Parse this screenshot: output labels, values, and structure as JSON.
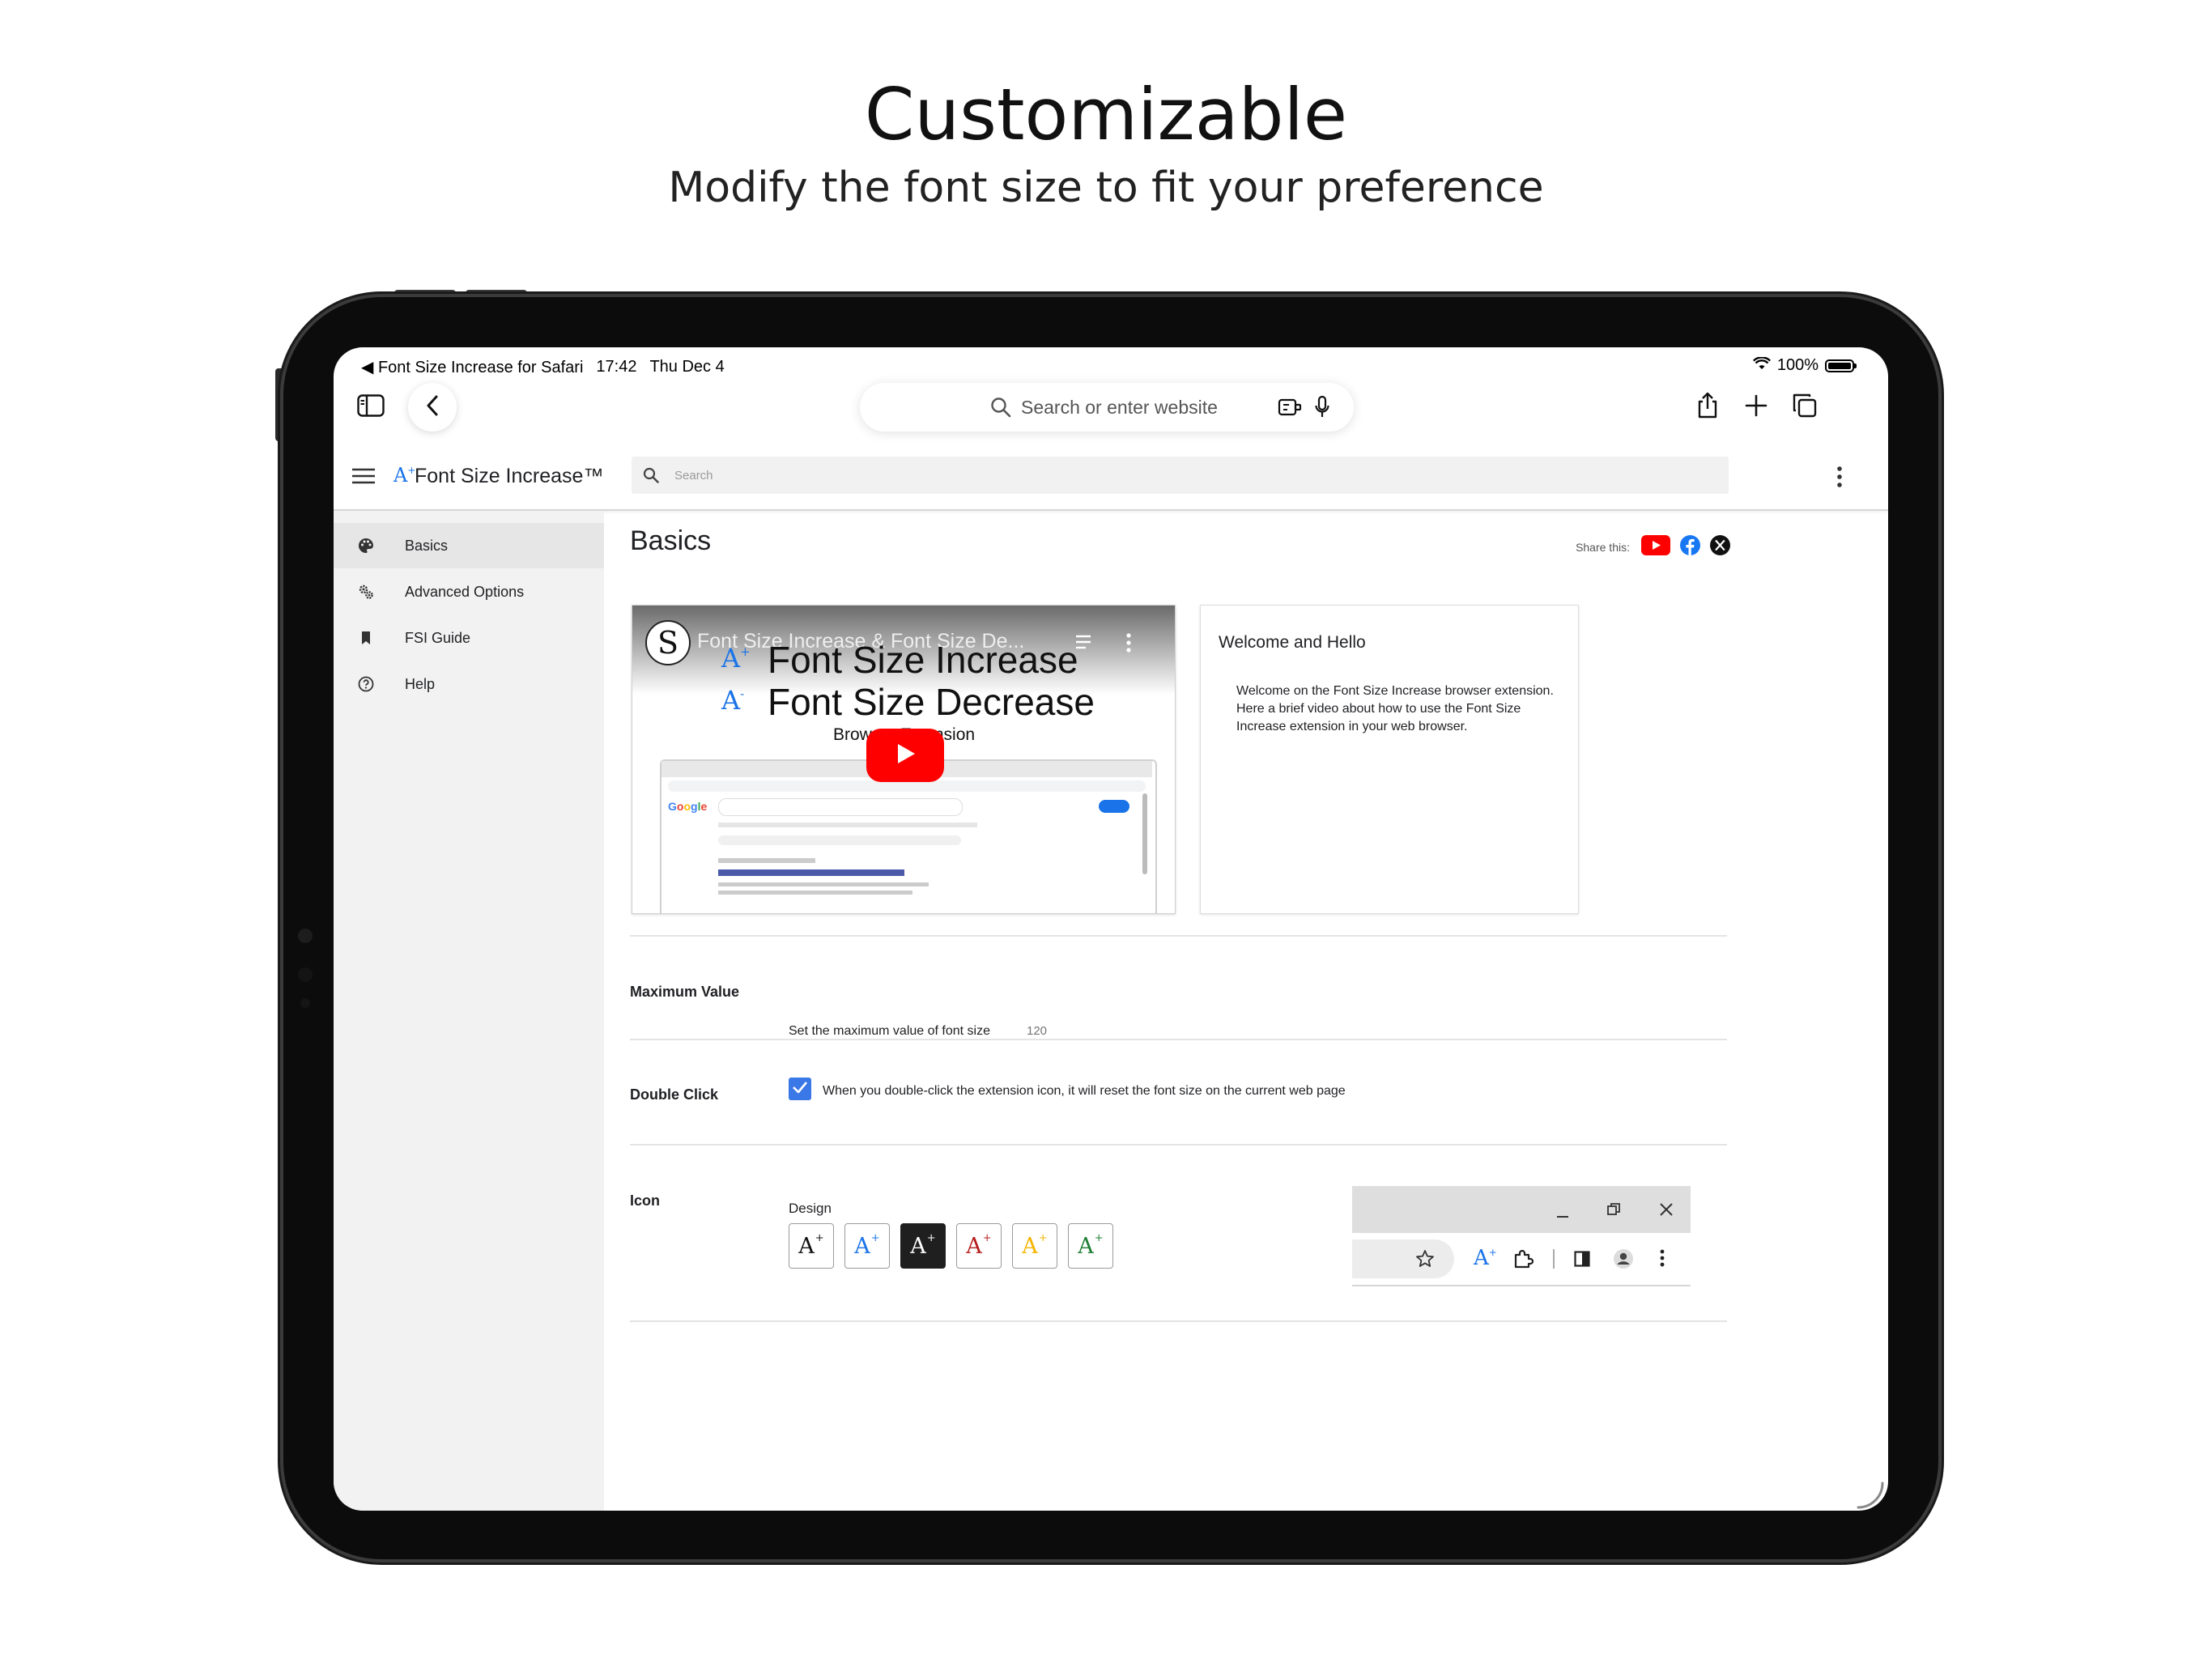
{
  "hero": {
    "title": "Customizable",
    "subtitle": "Modify the font size to fit your preference"
  },
  "status_bar": {
    "back_app": "◀ Font Size Increase for Safari",
    "time": "17:42",
    "date": "Thu Dec 4",
    "battery": "100%"
  },
  "safari": {
    "address_placeholder": "Search or enter website"
  },
  "app": {
    "title": "Font Size Increase™",
    "search_placeholder": "Search"
  },
  "sidebar": {
    "items": [
      {
        "label": "Basics",
        "icon": "palette-icon"
      },
      {
        "label": "Advanced Options",
        "icon": "gears-icon"
      },
      {
        "label": "FSI Guide",
        "icon": "bookmark-icon"
      },
      {
        "label": "Help",
        "icon": "help-circle-icon"
      }
    ]
  },
  "main": {
    "heading": "Basics",
    "share_label": "Share this:",
    "video": {
      "title": "Font Size Increase & Font Size De...",
      "line1": "Font Size Increase",
      "line2": "Font Size Decrease",
      "line3": "Browser Extension"
    },
    "welcome": {
      "title": "Welcome and Hello",
      "body": "Welcome on the Font Size Increase browser extension. Here a brief video about how to use the Font Size Increase extension in your web browser."
    },
    "max_value": {
      "label": "Maximum Value",
      "text": "Set the maximum value of font size",
      "placeholder": "120"
    },
    "double_click": {
      "label": "Double Click",
      "text": "When you double-click the extension icon, it will reset the font size on the current web page"
    },
    "icon": {
      "label": "Icon",
      "design_label": "Design",
      "glyph": "A",
      "options": [
        {
          "fg": "#111111",
          "bg": "#ffffff"
        },
        {
          "fg": "#1a73e8",
          "bg": "#ffffff"
        },
        {
          "fg": "#ffffff",
          "bg": "#1f1f1f"
        },
        {
          "fg": "#b71c1c",
          "bg": "#ffffff"
        },
        {
          "fg": "#f4b400",
          "bg": "#ffffff"
        },
        {
          "fg": "#1e7e34",
          "bg": "#ffffff"
        }
      ]
    }
  },
  "colors": {
    "accent": "#1a73e8",
    "checkbox": "#3b78e7",
    "youtube": "#ff0000",
    "facebook": "#1877f2"
  }
}
